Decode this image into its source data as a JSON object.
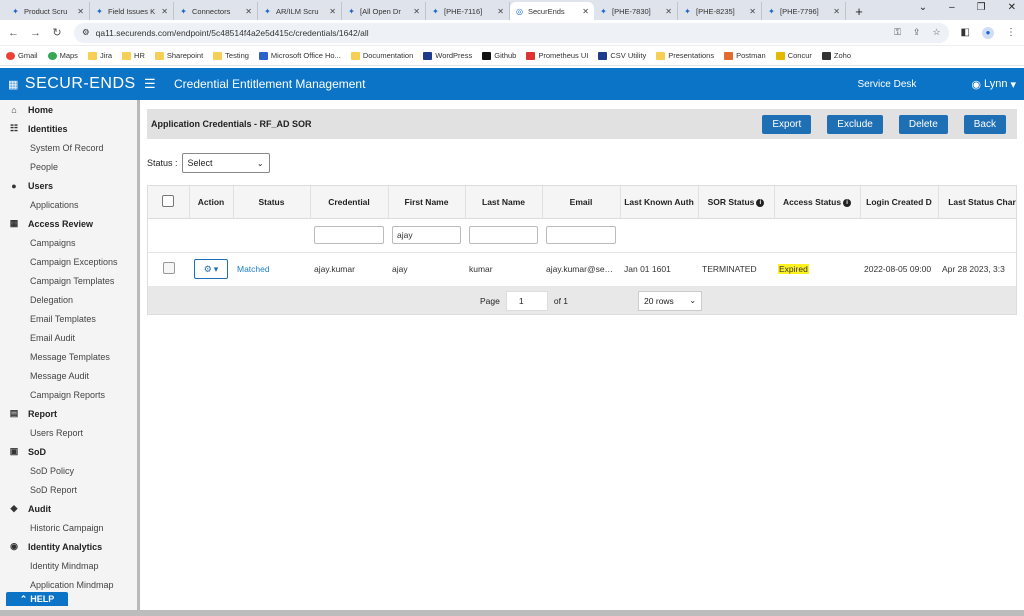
{
  "browser": {
    "tabs": [
      {
        "title": "Product Scru",
        "active": false
      },
      {
        "title": "Field Issues K",
        "active": false
      },
      {
        "title": "Connectors ",
        "active": false
      },
      {
        "title": "AR/ILM Scru",
        "active": false
      },
      {
        "title": "[All Open Dr",
        "active": false
      },
      {
        "title": "[PHE-7116] ",
        "active": false
      },
      {
        "title": "SecurEnds",
        "active": true
      },
      {
        "title": "[PHE-7830] ",
        "active": false
      },
      {
        "title": "[PHE-8235] ",
        "active": false
      },
      {
        "title": "[PHE-7796] ",
        "active": false
      }
    ],
    "url": "qa11.securends.com/endpoint/5c48514f4a2e5d415c/credentials/1642/all",
    "bookmarks": [
      "Gmail",
      "Maps",
      "Jira",
      "HR",
      "Sharepoint",
      "Testing",
      "Microsoft Office Ho...",
      "Documentation",
      "WordPress",
      "Github",
      "Prometheus UI",
      "CSV Utility",
      "Presentations",
      "Postman",
      "Concur",
      "Zoho"
    ]
  },
  "header": {
    "logo": "SECUR-ENDS",
    "title": "Credential Entitlement Management",
    "service_desk": "Service Desk",
    "user": "Lynn"
  },
  "sidebar": {
    "items": [
      {
        "label": "Home",
        "type": "section",
        "icon": "home-icon",
        "glyph": "⌂"
      },
      {
        "label": "Identities",
        "type": "section",
        "icon": "people-icon",
        "glyph": "☷"
      },
      {
        "label": "System Of Record",
        "type": "child"
      },
      {
        "label": "People",
        "type": "child"
      },
      {
        "label": "Users",
        "type": "section",
        "icon": "user-icon",
        "glyph": "●"
      },
      {
        "label": "Applications",
        "type": "child"
      },
      {
        "label": "Access Review",
        "type": "section",
        "icon": "grid-icon",
        "glyph": "▦"
      },
      {
        "label": "Campaigns",
        "type": "child"
      },
      {
        "label": "Campaign Exceptions",
        "type": "child"
      },
      {
        "label": "Campaign Templates",
        "type": "child"
      },
      {
        "label": "Delegation",
        "type": "child"
      },
      {
        "label": "Email Templates",
        "type": "child"
      },
      {
        "label": "Email Audit",
        "type": "child"
      },
      {
        "label": "Message Templates",
        "type": "child"
      },
      {
        "label": "Message Audit",
        "type": "child"
      },
      {
        "label": "Campaign Reports",
        "type": "child"
      },
      {
        "label": "Report",
        "type": "section",
        "icon": "report-icon",
        "glyph": "▤"
      },
      {
        "label": "Users Report",
        "type": "child"
      },
      {
        "label": "SoD",
        "type": "section",
        "icon": "sod-icon",
        "glyph": "▣"
      },
      {
        "label": "SoD Policy",
        "type": "child"
      },
      {
        "label": "SoD Report",
        "type": "child"
      },
      {
        "label": "Audit",
        "type": "section",
        "icon": "shield-icon",
        "glyph": "◆"
      },
      {
        "label": "Historic Campaign",
        "type": "child"
      },
      {
        "label": "Identity Analytics",
        "type": "section",
        "icon": "analytics-icon",
        "glyph": "◉"
      },
      {
        "label": "Identity Mindmap",
        "type": "child"
      },
      {
        "label": "Application Mindmap",
        "type": "child"
      }
    ],
    "help_label": "HELP"
  },
  "panel": {
    "title": "Application Credentials - RF_AD SOR",
    "buttons": {
      "export": "Export",
      "exclude": "Exclude",
      "delete": "Delete",
      "back": "Back"
    }
  },
  "status_filter": {
    "label": "Status :",
    "value": "Select"
  },
  "table": {
    "columns": [
      "",
      "Action",
      "Status",
      "Credential",
      "First Name",
      "Last Name",
      "Email",
      "Last Known Auth",
      "SOR Status",
      "Access Status",
      "Login Created D",
      "Last Status Char"
    ],
    "filters": {
      "credential": "",
      "first_name": "ajay",
      "last_name": "",
      "email": ""
    },
    "rows": [
      {
        "status": "Matched",
        "credential": "ajay.kumar",
        "first_name": "ajay",
        "last_name": "kumar",
        "email": "ajay.kumar@securends.com",
        "last_known_auth": "Jan 01 1601",
        "sor_status": "TERMINATED",
        "access_status": "Expired",
        "login_created": "2022-08-05 09:00",
        "last_status_change": "Apr 28 2023, 3:3"
      }
    ]
  },
  "pager": {
    "page_label": "Page",
    "page": "1",
    "of_label": "of 1",
    "rows": "20 rows"
  }
}
